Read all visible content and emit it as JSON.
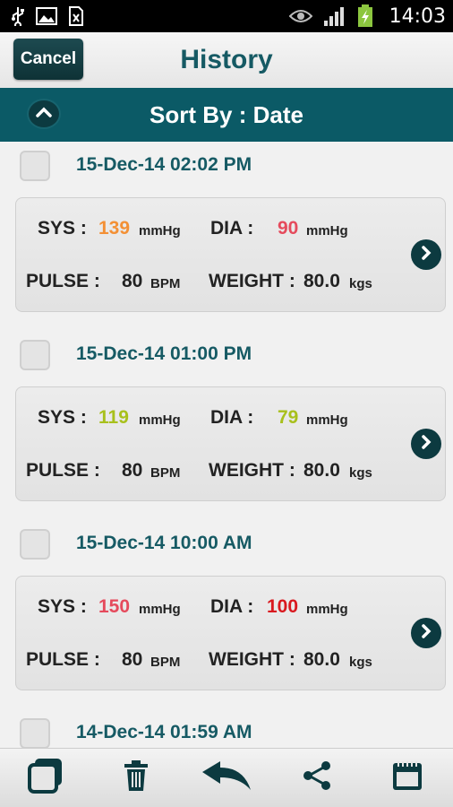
{
  "status_bar": {
    "time": "14:03"
  },
  "header": {
    "cancel_label": "Cancel",
    "title": "History"
  },
  "sort": {
    "label": "Sort By : Date"
  },
  "labels": {
    "sys": "SYS :",
    "dia": "DIA :",
    "pulse": "PULSE :",
    "weight": "WEIGHT :",
    "mmhg": "mmHg",
    "bpm": "BPM",
    "kgs": "kgs"
  },
  "entries": [
    {
      "date": "15-Dec-14 02:02 PM",
      "sys": "139",
      "dia": "90",
      "pulse": "80",
      "weight": "80.0",
      "sys_color": "#f39035",
      "dia_color": "#e54a5c"
    },
    {
      "date": "15-Dec-14 01:00 PM",
      "sys": "119",
      "dia": "79",
      "pulse": "80",
      "weight": "80.0",
      "sys_color": "#a8c01c",
      "dia_color": "#a8c01c"
    },
    {
      "date": "15-Dec-14 10:00 AM",
      "sys": "150",
      "dia": "100",
      "pulse": "80",
      "weight": "80.0",
      "sys_color": "#e54a5c",
      "dia_color": "#d9191f"
    },
    {
      "date": "14-Dec-14 01:59 AM"
    }
  ],
  "icons": {
    "status_left": [
      "usb-icon",
      "image-icon",
      "sim-icon"
    ],
    "status_right": [
      "eye-icon",
      "signal-icon",
      "battery-charging-icon"
    ],
    "bottom": [
      "select-all-icon",
      "delete-icon",
      "back-icon",
      "share-icon",
      "calendar-icon"
    ]
  },
  "colors": {
    "accent": "#0b5a66",
    "title": "#165a64"
  }
}
